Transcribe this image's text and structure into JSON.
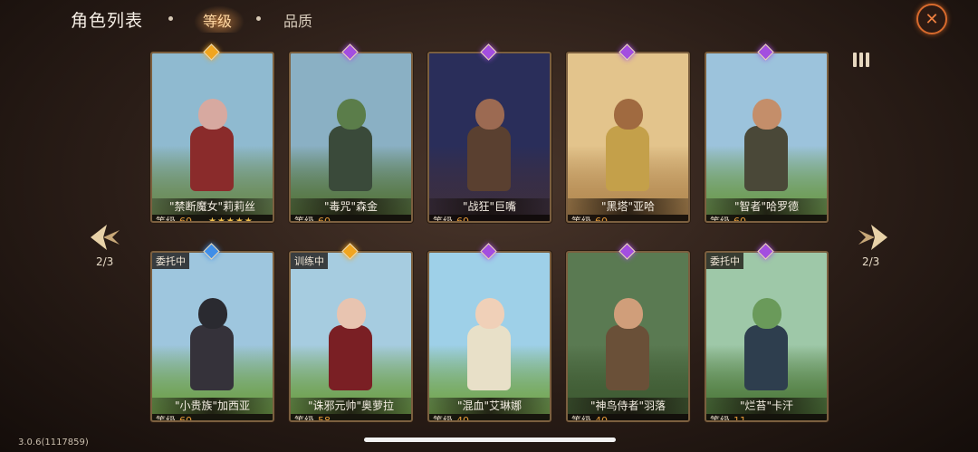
{
  "header": {
    "title": "角色列表",
    "tabs": [
      {
        "label": "等级",
        "active": true
      },
      {
        "label": "品质",
        "active": false
      }
    ]
  },
  "pager": {
    "left_label": "2/3",
    "right_label": "2/3"
  },
  "version": "3.0.6(1117859)",
  "level_label": "等级",
  "colors": {
    "accent": "#e39a3a",
    "purple_gem": "#a34ee0",
    "gold_gem": "#f0a520",
    "blue_gem": "#3f8ee8"
  },
  "cards": [
    {
      "name": "\"禁断魔女\"莉莉丝",
      "level": "60",
      "stars": "★★★★★",
      "stars_count": 5,
      "gem": "gold",
      "status": "",
      "palette": {
        "sky": "#8fbad0",
        "ground": "#6a8a52",
        "head": "#d7a9a0",
        "body": "#8a2b2b"
      }
    },
    {
      "name": "\"毒咒\"森金",
      "level": "60",
      "stars": "",
      "stars_count": 0,
      "gem": "purple",
      "status": "",
      "palette": {
        "sky": "#8ab0c4",
        "ground": "#55753e",
        "head": "#5b7d4a",
        "body": "#3a4a3a"
      }
    },
    {
      "name": "\"战狂\"巨嘴",
      "level": "60",
      "stars": "",
      "stars_count": 0,
      "gem": "purple",
      "status": "",
      "palette": {
        "sky": "#2a2e5a",
        "ground": "#3c2f40",
        "head": "#9c6a52",
        "body": "#5a4030"
      }
    },
    {
      "name": "\"黑塔\"亚哈",
      "level": "60",
      "stars": "",
      "stars_count": 0,
      "gem": "purple",
      "status": "",
      "palette": {
        "sky": "#e3c48c",
        "ground": "#b48a52",
        "head": "#a06a40",
        "body": "#c4a04a"
      }
    },
    {
      "name": "\"智者\"哈罗德",
      "level": "60",
      "stars": "",
      "stars_count": 0,
      "gem": "purple",
      "status": "",
      "palette": {
        "sky": "#9cc3dc",
        "ground": "#6c9a4e",
        "head": "#c48e6a",
        "body": "#4a4838"
      }
    },
    {
      "name": "\"小贵族\"加西亚",
      "level": "60",
      "stars": "",
      "stars_count": 0,
      "gem": "blue",
      "status": "委托中",
      "palette": {
        "sky": "#9ec6de",
        "ground": "#6ea04a",
        "head": "#2a2a30",
        "body": "#35323a"
      }
    },
    {
      "name": "\"诛邪元帅\"奥萝拉",
      "level": "58",
      "stars": "",
      "stars_count": 0,
      "gem": "gold",
      "status": "训练中",
      "palette": {
        "sky": "#a6cce0",
        "ground": "#6ea04a",
        "head": "#e8c4b0",
        "body": "#7a1f24"
      }
    },
    {
      "name": "\"混血\"艾琳娜",
      "level": "40",
      "stars": "",
      "stars_count": 0,
      "gem": "purple",
      "status": "",
      "palette": {
        "sky": "#9ed0e8",
        "ground": "#74a650",
        "head": "#f0d0b8",
        "body": "#e8e0c8"
      }
    },
    {
      "name": "\"神鸟侍者\"羽落",
      "level": "40",
      "stars": "",
      "stars_count": 0,
      "gem": "purple",
      "status": "",
      "palette": {
        "sky": "#5a7a52",
        "ground": "#3e5a32",
        "head": "#d09e7a",
        "body": "#6a5038"
      }
    },
    {
      "name": "\"烂苔\"卡汗",
      "level": "11",
      "stars": "",
      "stars_count": 0,
      "gem": "purple",
      "status": "委托中",
      "palette": {
        "sky": "#9ec8a8",
        "ground": "#4e7a3c",
        "head": "#6a9a5a",
        "body": "#2e3e4e"
      }
    }
  ]
}
